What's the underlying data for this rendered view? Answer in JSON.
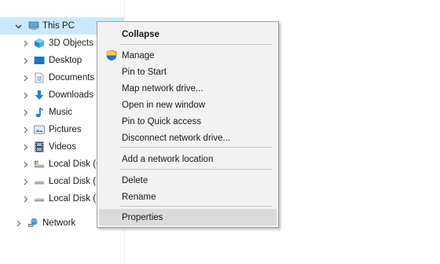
{
  "nav": {
    "this_pc": "This PC",
    "objects3d": "3D Objects",
    "desktop": "Desktop",
    "documents": "Documents",
    "downloads": "Downloads",
    "music": "Music",
    "pictures": "Pictures",
    "videos": "Videos",
    "local_c": "Local Disk (C",
    "local_d": "Local Disk (D",
    "local_e": "Local Disk (E",
    "network": "Network"
  },
  "menu": {
    "collapse": "Collapse",
    "manage": "Manage",
    "pin_start": "Pin to Start",
    "map_drive": "Map network drive...",
    "open_new_window": "Open in new window",
    "pin_quick": "Pin to Quick access",
    "disconnect": "Disconnect network drive...",
    "add_location": "Add a network location",
    "delete": "Delete",
    "rename": "Rename",
    "properties": "Properties"
  },
  "colors": {
    "selection": "#cce8ff",
    "menu_bg": "#f2f2f2",
    "menu_hover": "#dadada"
  },
  "icons": {
    "this_pc": "monitor-icon",
    "objects3d": "cube-icon",
    "desktop": "desktop-icon",
    "documents": "document-icon",
    "downloads": "download-arrow-icon",
    "music": "music-note-icon",
    "pictures": "picture-icon",
    "videos": "film-icon",
    "local_disk": "drive-icon",
    "network": "network-icon",
    "manage": "shield-icon"
  }
}
